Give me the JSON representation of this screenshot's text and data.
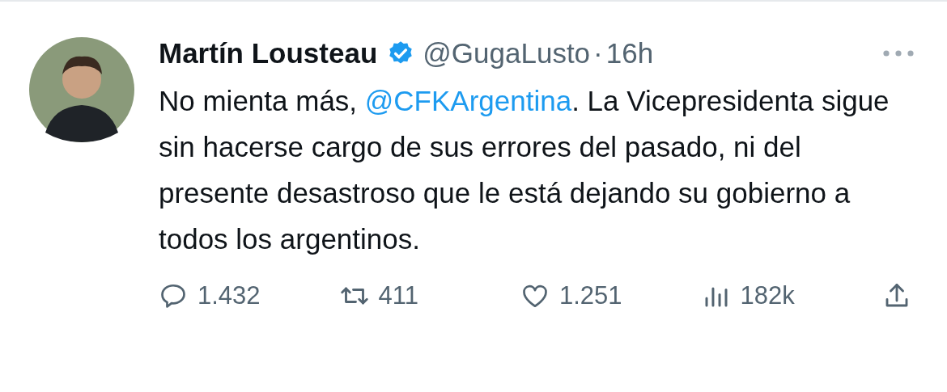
{
  "tweet": {
    "author": {
      "name": "Martín Lousteau",
      "verified": true,
      "handle": "@GugaLusto",
      "separator": "·",
      "time": "16h"
    },
    "body": {
      "before": "No mienta más, ",
      "mention": "@CFKArgentina",
      "after": ". La Vicepresidenta sigue sin hacerse cargo de sus errores del pasado, ni del presente desastroso que le está dejando su gobierno a todos los argentinos."
    },
    "actions": [
      {
        "kind": "reply",
        "count": "1.432"
      },
      {
        "kind": "retweet",
        "count": "411"
      },
      {
        "kind": "like",
        "count": "1.251"
      },
      {
        "kind": "views",
        "count": "182k"
      },
      {
        "kind": "share"
      }
    ]
  }
}
